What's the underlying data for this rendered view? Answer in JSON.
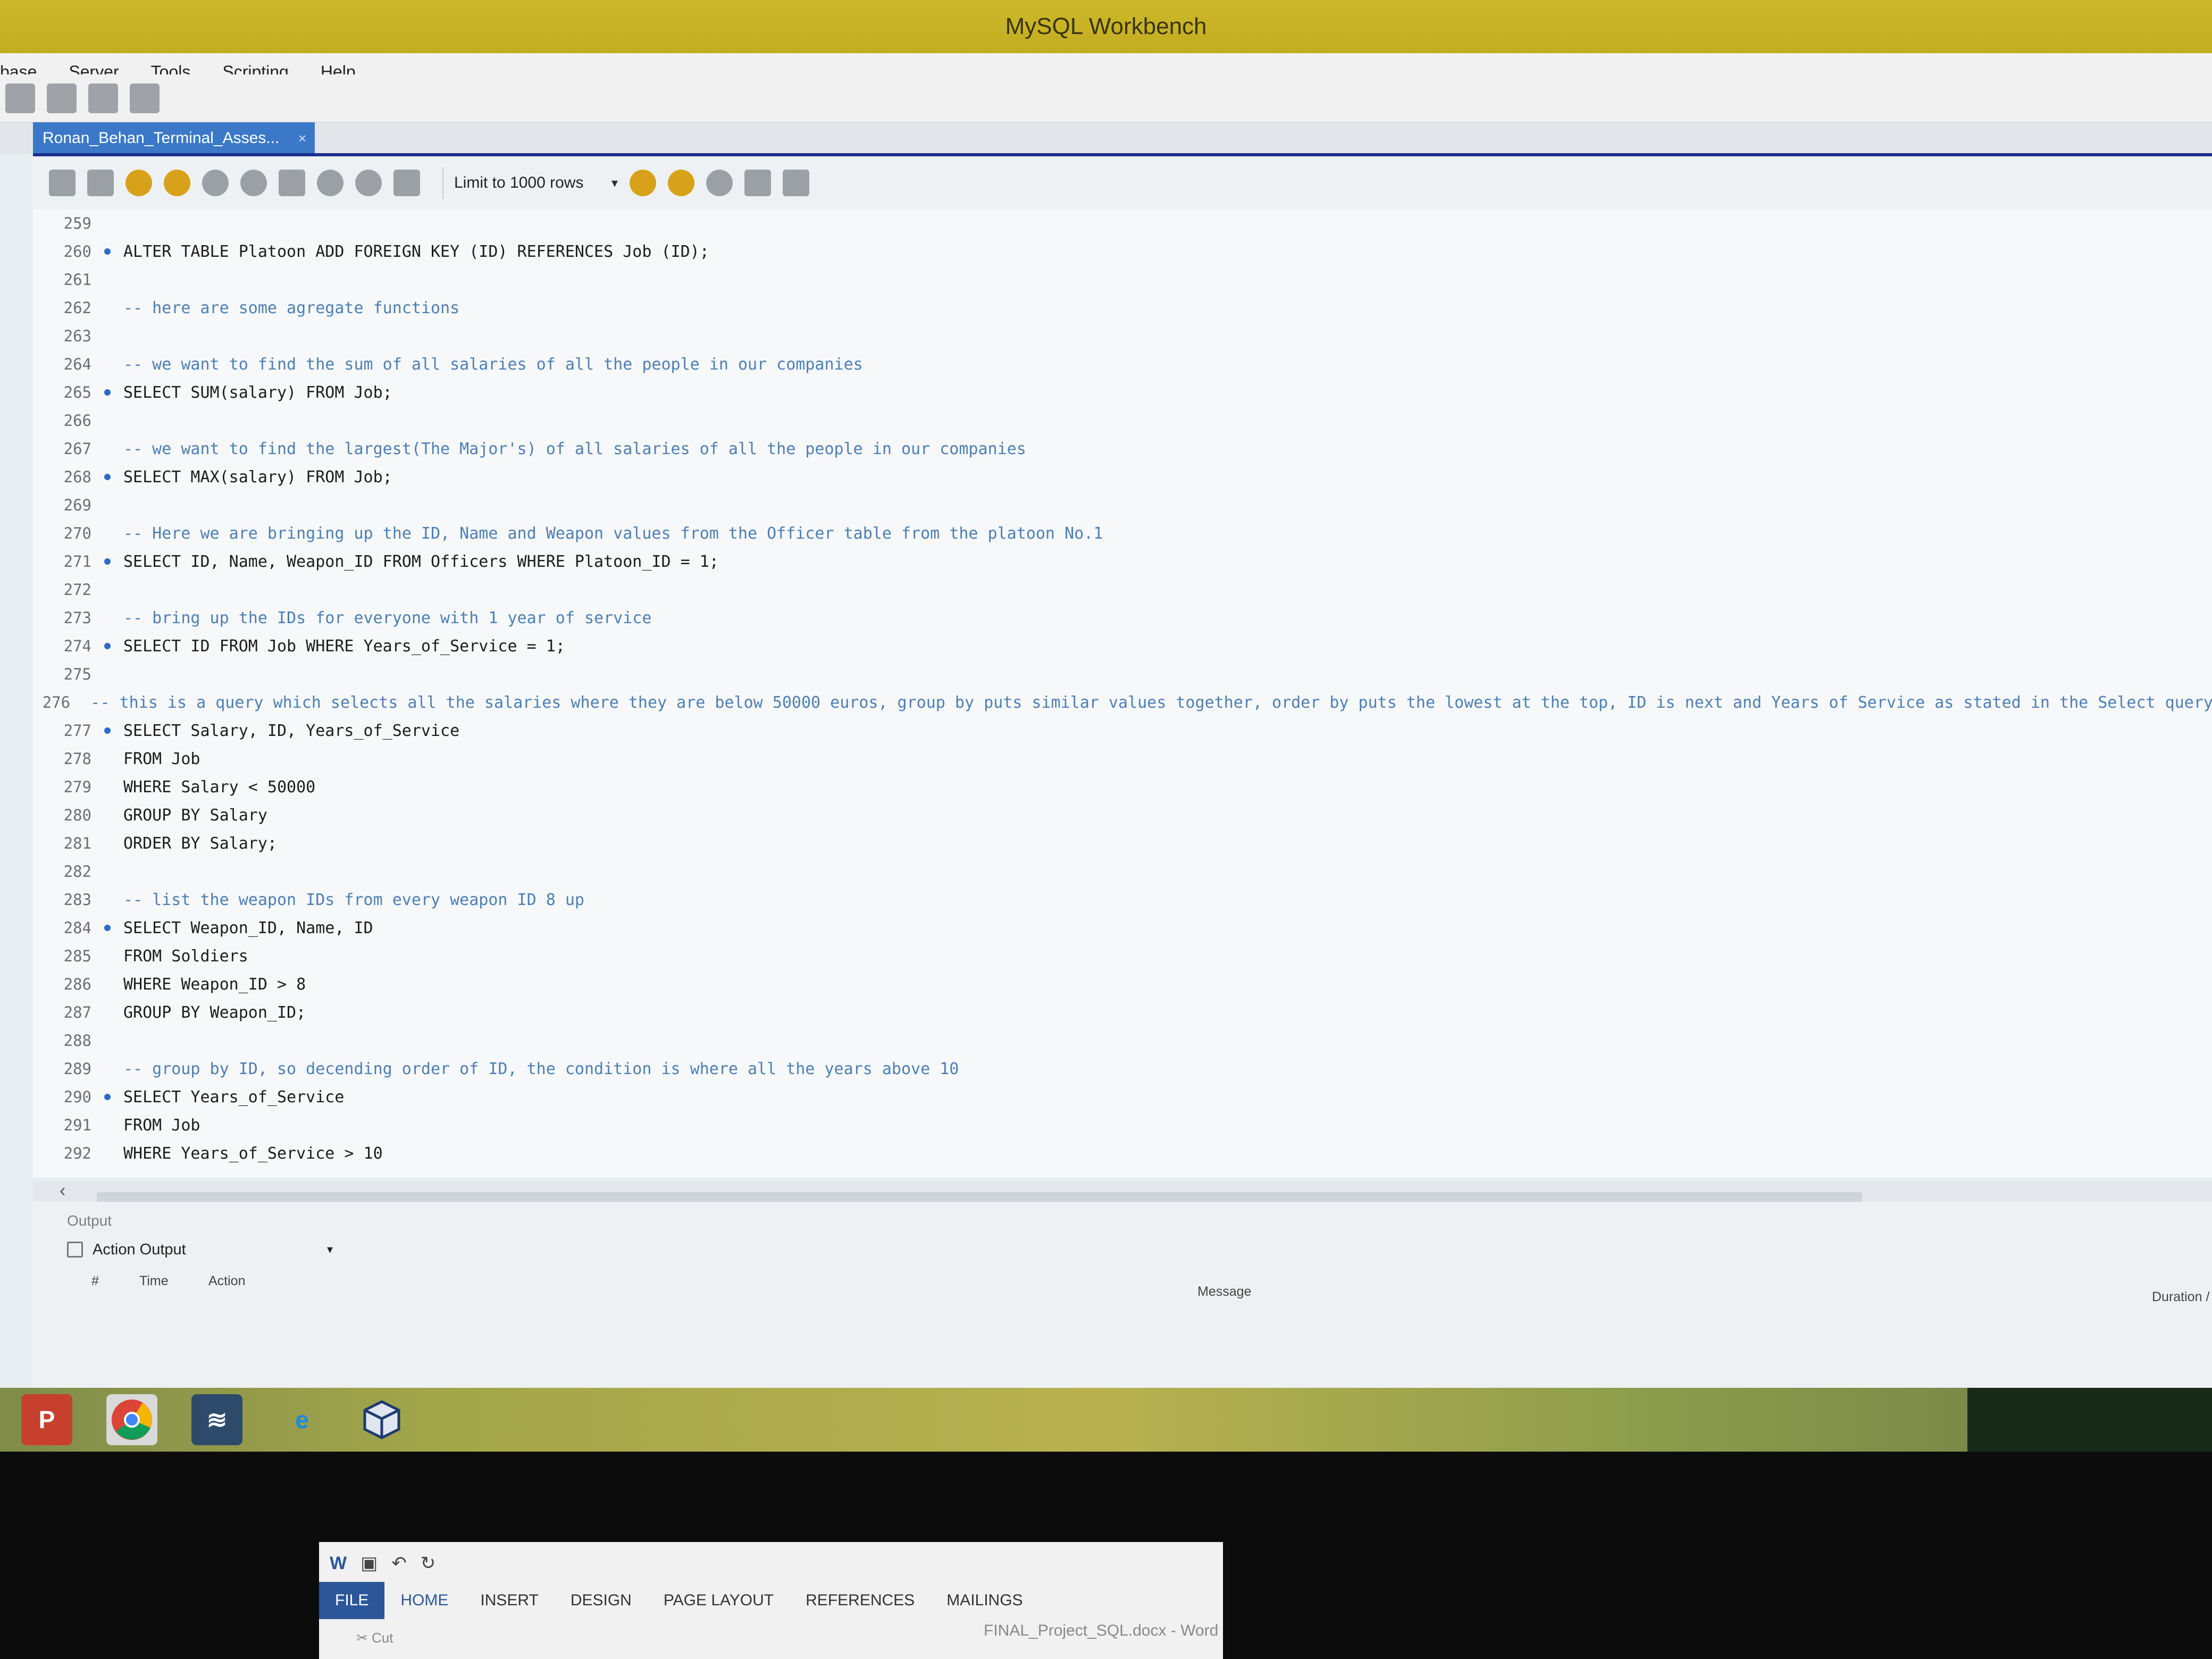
{
  "window": {
    "title": "MySQL Workbench"
  },
  "menu": [
    "base",
    "Server",
    "Tools",
    "Scripting",
    "Help"
  ],
  "tab": {
    "label": "Ronan_Behan_Terminal_Asses...",
    "close": "×"
  },
  "editor_toolbar": {
    "limit_label": "Limit to 1000 rows"
  },
  "code_lines": [
    {
      "n": "259",
      "dot": false,
      "text": "",
      "comment": false
    },
    {
      "n": "260",
      "dot": true,
      "text": "ALTER TABLE Platoon ADD FOREIGN KEY (ID) REFERENCES Job (ID);",
      "comment": false
    },
    {
      "n": "261",
      "dot": false,
      "text": "",
      "comment": false
    },
    {
      "n": "262",
      "dot": false,
      "text": "-- here are some agregate functions",
      "comment": true
    },
    {
      "n": "263",
      "dot": false,
      "text": "",
      "comment": false
    },
    {
      "n": "264",
      "dot": false,
      "text": "-- we want to find the sum of all salaries of all the people in our companies",
      "comment": true
    },
    {
      "n": "265",
      "dot": true,
      "text": "SELECT SUM(salary) FROM Job;",
      "comment": false
    },
    {
      "n": "266",
      "dot": false,
      "text": "",
      "comment": false
    },
    {
      "n": "267",
      "dot": false,
      "text": "-- we want to find the largest(The Major's) of all salaries of all the people in our companies",
      "comment": true
    },
    {
      "n": "268",
      "dot": true,
      "text": "SELECT MAX(salary) FROM Job;",
      "comment": false
    },
    {
      "n": "269",
      "dot": false,
      "text": "",
      "comment": false
    },
    {
      "n": "270",
      "dot": false,
      "text": "-- Here we are bringing up the ID, Name and Weapon values from the Officer table from the platoon No.1",
      "comment": true
    },
    {
      "n": "271",
      "dot": true,
      "text": "SELECT ID, Name, Weapon_ID FROM Officers WHERE Platoon_ID = 1;",
      "comment": false
    },
    {
      "n": "272",
      "dot": false,
      "text": "",
      "comment": false
    },
    {
      "n": "273",
      "dot": false,
      "text": "-- bring up the IDs for everyone with 1 year of service",
      "comment": true
    },
    {
      "n": "274",
      "dot": true,
      "text": "SELECT ID FROM Job WHERE Years_of_Service = 1;",
      "comment": false
    },
    {
      "n": "275",
      "dot": false,
      "text": "",
      "comment": false
    },
    {
      "n": "276",
      "dot": false,
      "text": "-- this is a query which selects all the salaries where they are below 50000 euros, group by puts similar values together, order by puts the lowest at the top, ID is next and Years of Service as stated in the Select query",
      "comment": true
    },
    {
      "n": "277",
      "dot": true,
      "text": "SELECT Salary, ID, Years_of_Service",
      "comment": false
    },
    {
      "n": "278",
      "dot": false,
      "text": "FROM Job",
      "comment": false
    },
    {
      "n": "279",
      "dot": false,
      "text": "WHERE Salary < 50000",
      "comment": false
    },
    {
      "n": "280",
      "dot": false,
      "text": "GROUP BY Salary",
      "comment": false
    },
    {
      "n": "281",
      "dot": false,
      "text": "ORDER BY Salary;",
      "comment": false
    },
    {
      "n": "282",
      "dot": false,
      "text": "",
      "comment": false
    },
    {
      "n": "283",
      "dot": false,
      "text": "-- list the weapon IDs from every weapon ID 8 up",
      "comment": true
    },
    {
      "n": "284",
      "dot": true,
      "text": "SELECT Weapon_ID, Name, ID",
      "comment": false
    },
    {
      "n": "285",
      "dot": false,
      "text": "FROM Soldiers",
      "comment": false
    },
    {
      "n": "286",
      "dot": false,
      "text": "WHERE Weapon_ID > 8",
      "comment": false
    },
    {
      "n": "287",
      "dot": false,
      "text": "GROUP BY Weapon_ID;",
      "comment": false
    },
    {
      "n": "288",
      "dot": false,
      "text": "",
      "comment": false
    },
    {
      "n": "289",
      "dot": false,
      "text": "-- group by ID, so decending order of ID, the condition is where all the years above 10",
      "comment": true
    },
    {
      "n": "290",
      "dot": true,
      "text": "SELECT Years_of_Service",
      "comment": false
    },
    {
      "n": "291",
      "dot": false,
      "text": "FROM Job",
      "comment": false
    },
    {
      "n": "292",
      "dot": false,
      "text": "WHERE Years_of_Service > 10",
      "comment": false
    }
  ],
  "output": {
    "label": "Output",
    "selector": "Action Output",
    "columns": {
      "num": "#",
      "time": "Time",
      "action": "Action",
      "message": "Message",
      "duration": "Duration /"
    }
  },
  "taskbar": [
    "powerpoint-icon",
    "chrome-icon",
    "mysql-workbench-icon",
    "internet-explorer-icon",
    "virtualbox-icon"
  ],
  "word": {
    "title": "FINAL_Project_SQL.docx - Word",
    "tabs": [
      "FILE",
      "HOME",
      "INSERT",
      "DESIGN",
      "PAGE LAYOUT",
      "REFERENCES",
      "MAILINGS"
    ],
    "cut_label": "Cut"
  }
}
